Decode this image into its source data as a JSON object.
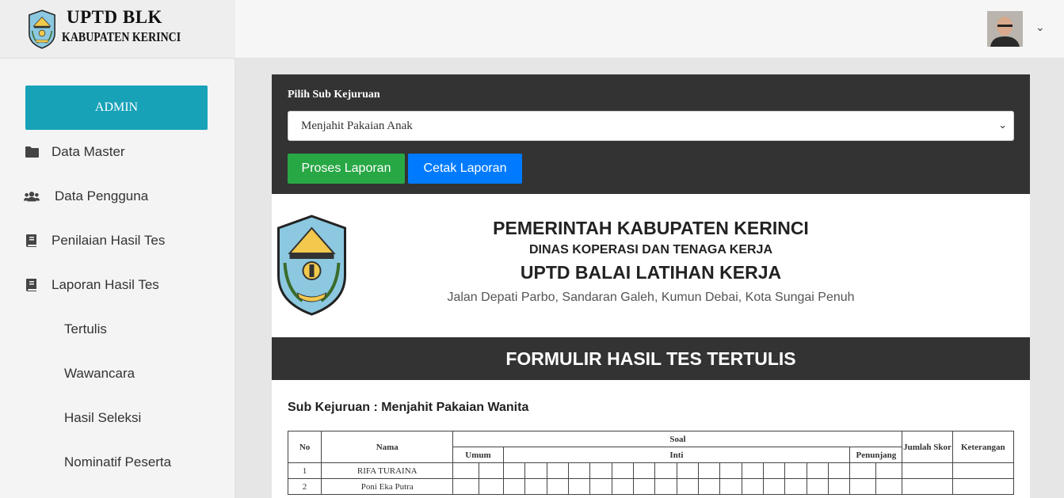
{
  "brand": {
    "title": "UPTD BLK",
    "subtitle": "KABUPATEN KERINCI"
  },
  "sidebar": {
    "role_button": "ADMIN",
    "items": [
      {
        "label": "Data Master",
        "icon": "folder-icon"
      },
      {
        "label": "Data Pengguna",
        "icon": "users-icon"
      },
      {
        "label": "Penilaian Hasil Tes",
        "icon": "book-icon"
      },
      {
        "label": "Laporan Hasil Tes",
        "icon": "book-icon"
      }
    ],
    "subitems": [
      "Tertulis",
      "Wawancara",
      "Hasil Seleksi",
      "Nominatif Peserta"
    ]
  },
  "topbar": {
    "avatar_icon": "user-avatar",
    "caret": "⌄"
  },
  "filter": {
    "label": "Pilih Sub Kejuruan",
    "selected": "Menjahit Pakaian Anak",
    "process_button": "Proses Laporan",
    "print_button": "Cetak Laporan"
  },
  "report": {
    "line1": "PEMERINTAH KABUPATEN KERINCI",
    "line2": "DINAS KOPERASI DAN TENAGA KERJA",
    "line3": "UPTD BALAI LATIHAN KERJA",
    "address": "Jalan Depati Parbo, Sandaran Galeh, Kumun Debai, Kota Sungai Penuh",
    "form_title": "FORMULIR HASIL TES TERTULIS",
    "sub_kejuruan": "Sub Kejuruan : Menjahit Pakaian Wanita"
  },
  "table": {
    "headers": {
      "no": "No",
      "nama": "Nama",
      "soal": "Soal",
      "umum": "Umum",
      "inti": "Inti",
      "penunjang": "Penunjang",
      "jumlah_skor": "Jumlah Skor",
      "keterangan": "Keterangan"
    },
    "rows": [
      {
        "no": "1",
        "nama": "RIFA TURAINA"
      },
      {
        "no": "2",
        "nama": "Poni Eka Putra"
      }
    ]
  },
  "colors": {
    "teal": "#17a2b8",
    "green": "#28a745",
    "blue": "#007bff",
    "dark": "#333333"
  }
}
